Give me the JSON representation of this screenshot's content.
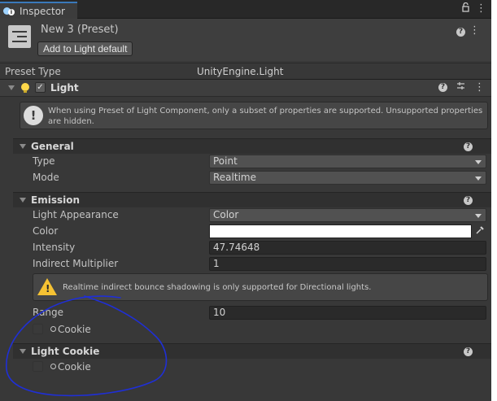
{
  "tab": {
    "title": "Inspector"
  },
  "header": {
    "preset_name": "New 3 (Preset)",
    "add_button": "Add to Light default",
    "preset_type_label": "Preset Type",
    "preset_type_value": "UnityEngine.Light"
  },
  "component": {
    "title": "Light",
    "enabled": true,
    "info": "When using Preset of Light Component, only a subset of properties are supported.  Unsupported properties are hidden."
  },
  "general": {
    "title": "General",
    "type_label": "Type",
    "type_value": "Point",
    "mode_label": "Mode",
    "mode_value": "Realtime"
  },
  "emission": {
    "title": "Emission",
    "appearance_label": "Light Appearance",
    "appearance_value": "Color",
    "color_label": "Color",
    "color_value": "#ffffff",
    "intensity_label": "Intensity",
    "intensity_value": "47.74648",
    "indirect_label": "Indirect Multiplier",
    "indirect_value": "1",
    "warning": "Realtime indirect bounce shadowing is only supported for Directional lights.",
    "range_label": "Range",
    "range_value": "10",
    "cookie_label": "Cookie"
  },
  "light_cookie": {
    "title": "Light Cookie",
    "cookie_label": "Cookie"
  },
  "colors": {
    "panel_bg": "#383838",
    "tab_accent": "#3a79bb",
    "annotation": "#1f2fd6",
    "warning_icon": "#f6c233"
  },
  "icons": {
    "help": "help-icon",
    "lock": "lock-icon",
    "menu": "kebab-menu-icon",
    "presets": "presets-icon",
    "eyedropper": "eyedropper-icon"
  }
}
